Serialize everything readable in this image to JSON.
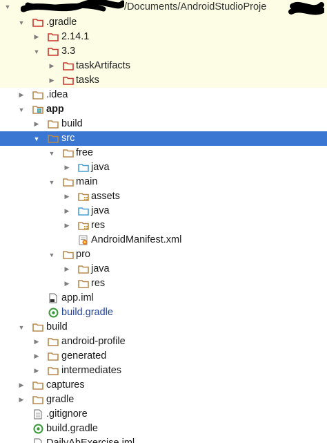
{
  "colors": {
    "highlight_bg": "#fdfde6",
    "selection_bg": "#3a77d2",
    "folder_excluded": "#c8372d",
    "folder_normal": "#b78a4e",
    "folder_source": "#4a9fd3",
    "module_file_blue": "#1f3f9c"
  },
  "tree": {
    "top_path": "/Documents/AndroidStudioProje",
    "rows": [
      {
        "label": ".gradle",
        "icon": "folder-excluded-icon",
        "arrow": "expanded"
      },
      {
        "label": "2.14.1",
        "icon": "folder-excluded-icon",
        "arrow": "collapsed"
      },
      {
        "label": "3.3",
        "icon": "folder-excluded-icon",
        "arrow": "expanded"
      },
      {
        "label": "taskArtifacts",
        "icon": "folder-excluded-icon",
        "arrow": "collapsed"
      },
      {
        "label": "tasks",
        "icon": "folder-excluded-icon",
        "arrow": "collapsed"
      },
      {
        "label": ".idea",
        "icon": "folder-icon",
        "arrow": "collapsed"
      },
      {
        "label": "app",
        "icon": "module-folder-icon",
        "arrow": "expanded"
      },
      {
        "label": "build",
        "icon": "folder-icon",
        "arrow": "collapsed"
      },
      {
        "label": "src",
        "icon": "folder-icon",
        "arrow": "expanded"
      },
      {
        "label": "free",
        "icon": "folder-icon",
        "arrow": "expanded"
      },
      {
        "label": "java",
        "icon": "source-folder-icon",
        "arrow": "collapsed"
      },
      {
        "label": "main",
        "icon": "folder-icon",
        "arrow": "expanded"
      },
      {
        "label": "assets",
        "icon": "resource-folder-icon",
        "arrow": "collapsed"
      },
      {
        "label": "java",
        "icon": "source-folder-icon",
        "arrow": "collapsed"
      },
      {
        "label": "res",
        "icon": "resource-folder-icon",
        "arrow": "collapsed"
      },
      {
        "label": "AndroidManifest.xml",
        "icon": "android-manifest-icon",
        "arrow": "none"
      },
      {
        "label": "pro",
        "icon": "folder-icon",
        "arrow": "expanded"
      },
      {
        "label": "java",
        "icon": "folder-icon",
        "arrow": "collapsed"
      },
      {
        "label": "res",
        "icon": "folder-icon",
        "arrow": "collapsed"
      },
      {
        "label": "app.iml",
        "icon": "iml-file-icon",
        "arrow": "none"
      },
      {
        "label": "build.gradle",
        "icon": "gradle-file-icon",
        "arrow": "none"
      },
      {
        "label": "build",
        "icon": "folder-icon",
        "arrow": "expanded"
      },
      {
        "label": "android-profile",
        "icon": "folder-icon",
        "arrow": "collapsed"
      },
      {
        "label": "generated",
        "icon": "folder-icon",
        "arrow": "collapsed"
      },
      {
        "label": "intermediates",
        "icon": "folder-icon",
        "arrow": "collapsed"
      },
      {
        "label": "captures",
        "icon": "folder-icon",
        "arrow": "collapsed"
      },
      {
        "label": "gradle",
        "icon": "folder-icon",
        "arrow": "collapsed"
      },
      {
        "label": ".gitignore",
        "icon": "text-file-icon",
        "arrow": "none"
      },
      {
        "label": "build.gradle",
        "icon": "gradle-file-icon",
        "arrow": "none"
      },
      {
        "label": "DailyAbExercise.iml",
        "icon": "iml-file-icon",
        "arrow": "none"
      }
    ]
  }
}
